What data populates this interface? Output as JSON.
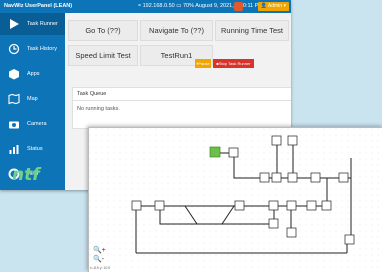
{
  "app": {
    "title": "NavWiz UserPanel (LEAN)"
  },
  "status_bar": {
    "ip": "192.168.0.50",
    "battery": "70%",
    "datetime": "August 9, 2021, 2:50:11 PM",
    "user": "Admin"
  },
  "sidebar": {
    "items": [
      {
        "label": "Task Runner",
        "icon": "play-icon"
      },
      {
        "label": "Task History",
        "icon": "history-icon"
      },
      {
        "label": "Apps",
        "icon": "box-icon"
      },
      {
        "label": "Map",
        "icon": "map-icon"
      },
      {
        "label": "Camera",
        "icon": "camera-icon"
      },
      {
        "label": "Status",
        "icon": "bar-chart-icon"
      },
      {
        "label": "Help",
        "icon": "lifebuoy-icon"
      }
    ]
  },
  "tasks": {
    "buttons": [
      "Go To (??)",
      "Navigate To (??)",
      "Running Time Test",
      "Speed Limit Test",
      "TestRun1"
    ]
  },
  "controls": {
    "pause": "Pause",
    "stop": "Stop Task Runner"
  },
  "queue": {
    "title": "Task Queue",
    "empty": "No running tasks."
  },
  "map": {
    "zoom_in": "+",
    "zoom_out": "-",
    "coords": "x:-8.5 y: 10.0",
    "start_color": "#6cc04a"
  }
}
